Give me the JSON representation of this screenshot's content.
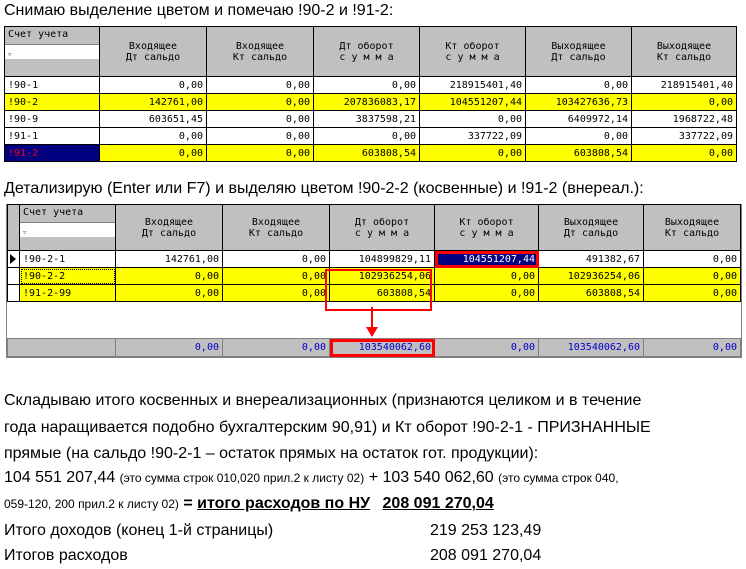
{
  "intro1": "Снимаю выделение цветом и помечаю !90-2 и !91-2:",
  "table1": {
    "headers": [
      [
        "Счет учета",
        ""
      ],
      [
        "Входящее",
        "Дт сальдо"
      ],
      [
        "Входящее",
        "Кт сальдо"
      ],
      [
        "Дт оборот",
        "с у м м а"
      ],
      [
        "Кт оборот",
        "с у м м а"
      ],
      [
        "Выходящее",
        "Дт сальдо"
      ],
      [
        "Выходящее",
        "Кт сальдо"
      ]
    ],
    "rows": [
      [
        "!90-1",
        "0,00",
        "0,00",
        "0,00",
        "218915401,40",
        "0,00",
        "218915401,40"
      ],
      [
        "!90-2",
        "142761,00",
        "0,00",
        "207836083,17",
        "104551207,44",
        "103427636,73",
        "0,00"
      ],
      [
        "!90-9",
        "603651,45",
        "0,00",
        "3837598,21",
        "0,00",
        "6409972,14",
        "1968722,48"
      ],
      [
        "!91-1",
        "0,00",
        "0,00",
        "0,00",
        "337722,09",
        "0,00",
        "337722,09"
      ],
      [
        "!91-2",
        "0,00",
        "0,00",
        "603808,54",
        "0,00",
        "603808,54",
        "0,00"
      ]
    ]
  },
  "intro2": "Детализирую (Enter или F7) и выделяю цветом !90-2-2 (косвенные) и !91-2 (внереал.):",
  "table2": {
    "headers": [
      [
        "Счет учета",
        ""
      ],
      [
        "Входящее",
        "Дт сальдо"
      ],
      [
        "Входящее",
        "Кт сальдо"
      ],
      [
        "Дт оборот",
        "с у м м а"
      ],
      [
        "Кт оборот",
        "с у м м а"
      ],
      [
        "Выходящее",
        "Дт сальдо"
      ],
      [
        "Выходящее",
        "Кт сальдо"
      ]
    ],
    "rows": [
      [
        "!90-2-1",
        "142761,00",
        "0,00",
        "104899829,11",
        "104551207,44",
        "491382,67",
        "0,00"
      ],
      [
        "!90-2-2",
        "0,00",
        "0,00",
        "102936254,06",
        "0,00",
        "102936254,06",
        "0,00"
      ],
      [
        "!91-2-99",
        "0,00",
        "0,00",
        "603808,54",
        "0,00",
        "603808,54",
        "0,00"
      ]
    ],
    "totals": [
      "0,00",
      "0,00",
      "103540062,60",
      "0,00",
      "103540062,60",
      "0,00"
    ]
  },
  "para": [
    "Складываю итого косвенных и внереализационных (признаются целиком и в течение",
    "года наращивается подобно бухгалтерским 90,91) и Кт оборот !90-2-1 - ПРИЗНАННЫЕ",
    "прямые (на сальдо !90-2-1 – остаток прямых на остаток гот. продукции):"
  ],
  "sum_line1_a": "104 551 207,44",
  "sum_line1_b": "(это сумма строк 010,020 прил.2 к листу 02)",
  "sum_line1_c": "+ 103 540 062,60",
  "sum_line1_d": "(это сумма строк 040,",
  "sum_line2_a": "059-120, 200 прил.2 к листу 02)",
  "sum_line2_b": "=",
  "sum_line2_c": "итого расходов по НУ",
  "sum_line2_d": "208 091 270,04",
  "income_label": "Итого доходов (конец 1-й страницы)",
  "income_value": "219 253 123,49",
  "expense_label": "Итогов расходов",
  "expense_value": "208 091 270,04",
  "colors": {
    "highlight": "#ffff00",
    "selection": "#000080",
    "marker": "#ff0000",
    "header": "#c0c0c0"
  }
}
